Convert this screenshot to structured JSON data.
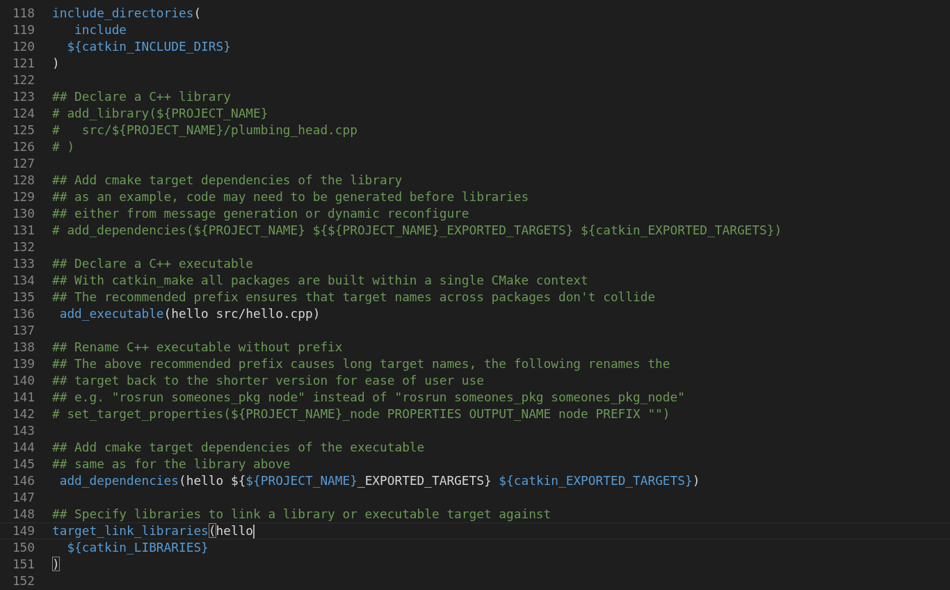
{
  "editor": {
    "lines": [
      {
        "number": "118",
        "tokens": [
          {
            "kind": "function",
            "text": "include_directories"
          },
          {
            "kind": "plain",
            "text": "("
          }
        ]
      },
      {
        "number": "119",
        "tokens": [
          {
            "kind": "function",
            "text": "   include"
          }
        ]
      },
      {
        "number": "120",
        "tokens": [
          {
            "kind": "function",
            "text": "  ${catkin_INCLUDE_DIRS}"
          }
        ]
      },
      {
        "number": "121",
        "tokens": [
          {
            "kind": "plain",
            "text": ")"
          }
        ]
      },
      {
        "number": "122"
      },
      {
        "number": "123",
        "tokens": [
          {
            "kind": "comment",
            "text": "## Declare a C++ library"
          }
        ]
      },
      {
        "number": "124",
        "tokens": [
          {
            "kind": "comment",
            "text": "# add_library(${PROJECT_NAME}"
          }
        ]
      },
      {
        "number": "125",
        "tokens": [
          {
            "kind": "comment",
            "text": "#   src/${PROJECT_NAME}/plumbing_head.cpp"
          }
        ]
      },
      {
        "number": "126",
        "tokens": [
          {
            "kind": "comment",
            "text": "# )"
          }
        ]
      },
      {
        "number": "127"
      },
      {
        "number": "128",
        "tokens": [
          {
            "kind": "comment",
            "text": "## Add cmake target dependencies of the library"
          }
        ]
      },
      {
        "number": "129",
        "tokens": [
          {
            "kind": "comment",
            "text": "## as an example, code may need to be generated before libraries"
          }
        ]
      },
      {
        "number": "130",
        "tokens": [
          {
            "kind": "comment",
            "text": "## either from message generation or dynamic reconfigure"
          }
        ]
      },
      {
        "number": "131",
        "tokens": [
          {
            "kind": "comment",
            "text": "# add_dependencies(${PROJECT_NAME} ${${PROJECT_NAME}_EXPORTED_TARGETS} ${catkin_EXPORTED_TARGETS})"
          }
        ]
      },
      {
        "number": "132"
      },
      {
        "number": "133",
        "tokens": [
          {
            "kind": "comment",
            "text": "## Declare a C++ executable"
          }
        ]
      },
      {
        "number": "134",
        "tokens": [
          {
            "kind": "comment",
            "text": "## With catkin_make all packages are built within a single CMake context"
          }
        ]
      },
      {
        "number": "135",
        "tokens": [
          {
            "kind": "comment",
            "text": "## The recommended prefix ensures that target names across packages don't collide"
          }
        ]
      },
      {
        "number": "136",
        "tokens": [
          {
            "kind": "function",
            "text": " add_executable"
          },
          {
            "kind": "plain",
            "text": "(hello src/hello.cpp)"
          }
        ]
      },
      {
        "number": "137"
      },
      {
        "number": "138",
        "tokens": [
          {
            "kind": "comment",
            "text": "## Rename C++ executable without prefix"
          }
        ]
      },
      {
        "number": "139",
        "tokens": [
          {
            "kind": "comment",
            "text": "## The above recommended prefix causes long target names, the following renames the"
          }
        ]
      },
      {
        "number": "140",
        "tokens": [
          {
            "kind": "comment",
            "text": "## target back to the shorter version for ease of user use"
          }
        ]
      },
      {
        "number": "141",
        "tokens": [
          {
            "kind": "comment",
            "text": "## e.g. \"rosrun someones_pkg node\" instead of \"rosrun someones_pkg someones_pkg_node\""
          }
        ]
      },
      {
        "number": "142",
        "tokens": [
          {
            "kind": "comment",
            "text": "# set_target_properties(${PROJECT_NAME}_node PROPERTIES OUTPUT_NAME node PREFIX \"\")"
          }
        ]
      },
      {
        "number": "143"
      },
      {
        "number": "144",
        "tokens": [
          {
            "kind": "comment",
            "text": "## Add cmake target dependencies of the executable"
          }
        ]
      },
      {
        "number": "145",
        "tokens": [
          {
            "kind": "comment",
            "text": "## same as for the library above"
          }
        ]
      },
      {
        "number": "146",
        "tokens": [
          {
            "kind": "function",
            "text": " add_dependencies"
          },
          {
            "kind": "plain",
            "text": "(hello ${"
          },
          {
            "kind": "function",
            "text": "${PROJECT_NAME}"
          },
          {
            "kind": "plain",
            "text": "_EXPORTED_TARGETS} "
          },
          {
            "kind": "function",
            "text": "${catkin_EXPORTED_TARGETS}"
          },
          {
            "kind": "plain",
            "text": ")"
          }
        ]
      },
      {
        "number": "147"
      },
      {
        "number": "148",
        "tokens": [
          {
            "kind": "comment",
            "text": "## Specify libraries to link a library or executable target against"
          }
        ]
      },
      {
        "number": "149",
        "current": true,
        "tokens": [
          {
            "kind": "function",
            "text": "target_link_libraries"
          },
          {
            "kind": "bracket",
            "text": "("
          },
          {
            "kind": "plain",
            "text": "hello"
          }
        ]
      },
      {
        "number": "150",
        "tokens": [
          {
            "kind": "function",
            "text": "  ${catkin_LIBRARIES}"
          }
        ]
      },
      {
        "number": "151",
        "tokens": [
          {
            "kind": "bracket",
            "text": ")"
          }
        ]
      },
      {
        "number": "152"
      }
    ]
  }
}
